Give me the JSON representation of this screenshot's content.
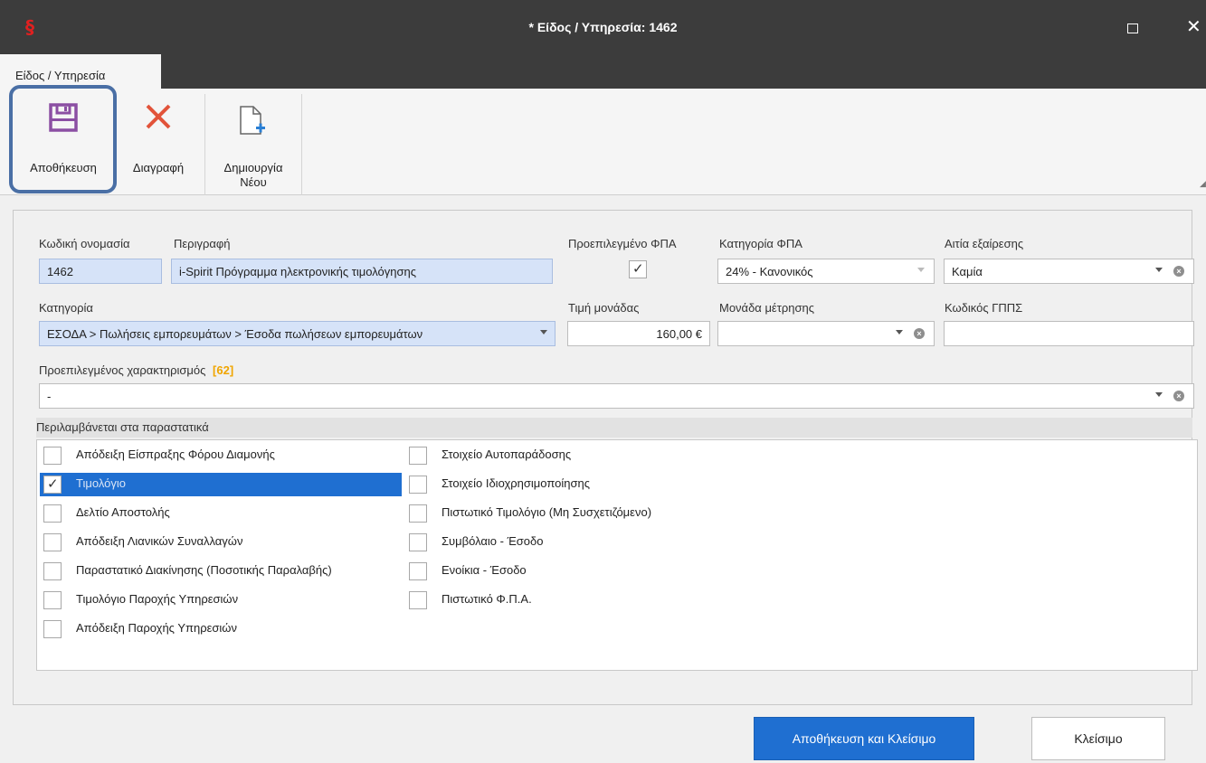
{
  "window": {
    "title": "* Είδος / Υπηρεσία: 1462",
    "app_icon": "§"
  },
  "ribbon": {
    "tab_label": "Είδος / Υπηρεσία",
    "save_label": "Αποθήκευση",
    "delete_label": "Διαγραφή",
    "new_label_line1": "Δημιουργία",
    "new_label_line2": "Νέου"
  },
  "form": {
    "code_label": "Κωδική ονομασία",
    "code_value": "1462",
    "description_label": "Περιγραφή",
    "description_value": "i-Spirit Πρόγραμμα ηλεκτρονικής τιμολόγησης",
    "default_vat_label": "Προεπιλεγμένο ΦΠΑ",
    "default_vat_checked": true,
    "vat_category_label": "Κατηγορία ΦΠΑ",
    "vat_category_value": "24% - Κανονικός",
    "exemption_label": "Αιτία εξαίρεσης",
    "exemption_value": "Καμία",
    "category_label": "Κατηγορία",
    "category_value": "ΕΣΟΔΑ > Πωλήσεις εμπορευμάτων > Έσοδα πωλήσεων εμπορευμάτων",
    "unit_price_label": "Τιμή μονάδας",
    "unit_price_value": "160,00 €",
    "unit_label": "Μονάδα μέτρησης",
    "unit_value": "",
    "gpps_label": "Κωδικός ΓΠΠΣ",
    "gpps_value": "",
    "characterization_label": "Προεπιλεγμένος χαρακτηρισμός",
    "characterization_count": "[62]",
    "characterization_value": "-"
  },
  "included_docs": {
    "title": "Περιλαμβάνεται στα παραστατικά",
    "left": [
      {
        "label": "Απόδειξη Είσπραξης Φόρου Διαμονής",
        "checked": false
      },
      {
        "label": "Τιμολόγιο",
        "checked": true
      },
      {
        "label": "Δελτίο Αποστολής",
        "checked": false
      },
      {
        "label": "Απόδειξη Λιανικών Συναλλαγών",
        "checked": false
      },
      {
        "label": "Παραστατικό Διακίνησης (Ποσοτικής Παραλαβής)",
        "checked": false
      },
      {
        "label": "Τιμολόγιο Παροχής Υπηρεσιών",
        "checked": false
      },
      {
        "label": "Απόδειξη Παροχής Υπηρεσιών",
        "checked": false
      }
    ],
    "right": [
      {
        "label": "Στοιχείο Αυτοπαράδοσης",
        "checked": false
      },
      {
        "label": "Στοιχείο Ιδιοχρησιμοποίησης",
        "checked": false
      },
      {
        "label": "Πιστωτικό Τιμολόγιο (Μη Συσχετιζόμενο)",
        "checked": false
      },
      {
        "label": "Συμβόλαιο - Έσοδο",
        "checked": false
      },
      {
        "label": "Ενοίκια - Έσοδο",
        "checked": false
      },
      {
        "label": "Πιστωτικό Φ.Π.Α.",
        "checked": false
      }
    ]
  },
  "footer": {
    "save_close_label": "Αποθήκευση και Κλείσιμο",
    "close_label": "Κλείσιμο"
  },
  "colors": {
    "accent": "#1f6fd1",
    "save_icon": "#8b4fa3",
    "delete_icon": "#e2533a",
    "highlight_outline": "#4a6fa5"
  }
}
